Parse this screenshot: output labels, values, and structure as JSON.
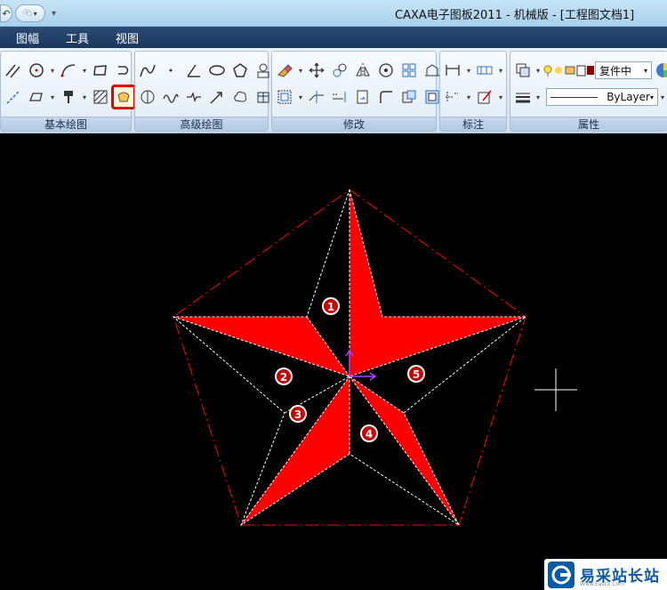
{
  "titlebar": {
    "title": "CAXA电子图板2011 - 机械版 - [工程图文档1]",
    "quick_access_dropdown": "▾"
  },
  "menu": {
    "items": [
      "图幅",
      "工具",
      "视图"
    ]
  },
  "ribbon": {
    "panels": {
      "basic_draw": "基本绘图",
      "advanced_draw": "高级绘图",
      "modify": "修改",
      "annotate": "标注",
      "properties": "属性"
    },
    "layer_name": "复件中",
    "linetype_value": "ByLayer"
  },
  "canvas": {
    "star_color": "#ff0000",
    "background": "#000000",
    "region_labels": [
      "1",
      "2",
      "3",
      "4",
      "5"
    ]
  },
  "watermark": {
    "text": "易采站长站",
    "sub": "Www.Easck.Com"
  }
}
